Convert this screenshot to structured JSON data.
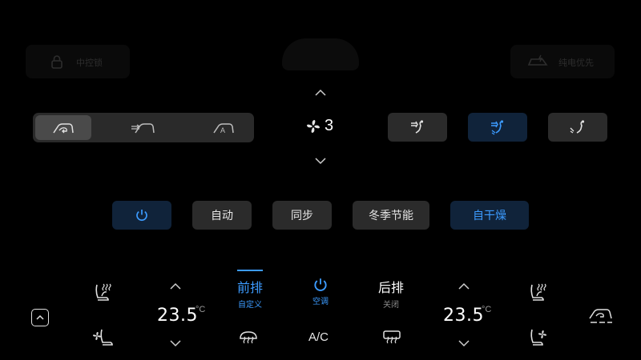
{
  "ghost": {
    "left_label": "中控锁",
    "right_label": "纯电优先"
  },
  "fan": {
    "level": "3"
  },
  "controls": {
    "auto_label": "自动",
    "sync_label": "同步",
    "winter_label": "冬季节能",
    "dry_label": "自干燥"
  },
  "bottom": {
    "left_temp": "23.5",
    "right_temp": "23.5",
    "unit": "°C",
    "front_label": "前排",
    "front_sub": "自定义",
    "ac_power_sub": "空调",
    "rear_label": "后排",
    "rear_sub": "关闭",
    "ac_label": "A/C"
  },
  "colors": {
    "accent": "#3c9bff",
    "active_bg": "#10233a",
    "button_bg": "#2b2b2b"
  }
}
